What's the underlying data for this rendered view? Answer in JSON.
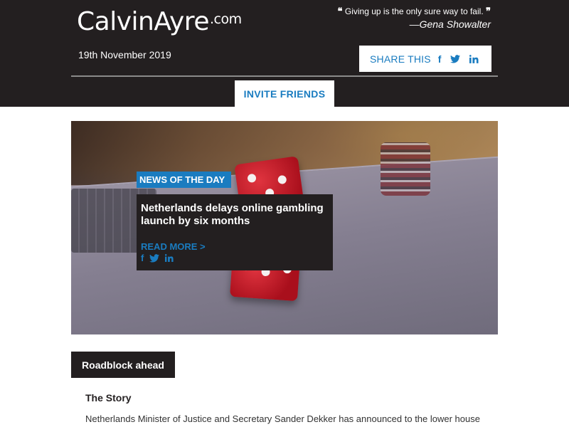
{
  "header": {
    "logo_main": "CalvinAyre",
    "logo_suffix": ".com",
    "quote_text": "Giving up is the only sure way to fail.",
    "quote_author": "—Gena Showalter",
    "date": "19th November 2019",
    "share_label": "SHARE THIS",
    "share_icons": [
      "facebook-icon",
      "twitter-icon",
      "linkedin-icon"
    ],
    "invite_label": "INVITE FRIENDS"
  },
  "hero": {
    "tag": "NEWS OF THE DAY",
    "title": "Netherlands delays online gambling launch by six months",
    "read_more": "READ MORE >",
    "share_icons": [
      "facebook-icon",
      "twitter-icon",
      "linkedin-icon"
    ]
  },
  "section": {
    "label": "Roadblock ahead",
    "story_heading": "The Story",
    "story_text": "Netherlands Minister of Justice and Secretary Sander Dekker has announced to the lower house"
  },
  "colors": {
    "header_bg": "#231f20",
    "accent_blue": "#1a7cc0",
    "white": "#ffffff"
  }
}
